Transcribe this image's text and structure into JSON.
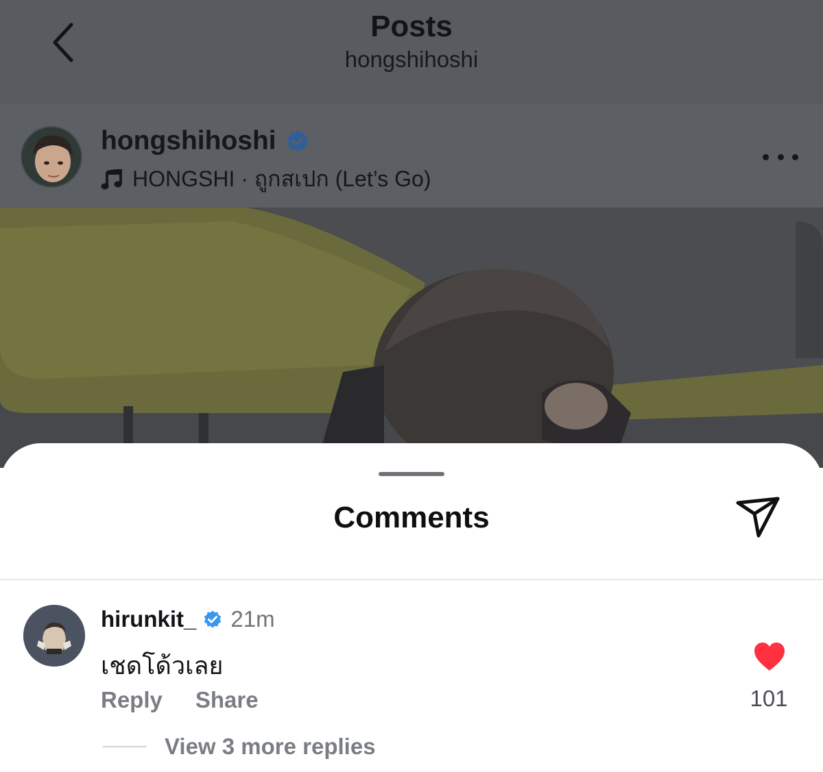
{
  "header": {
    "title": "Posts",
    "subtitle": "hongshihoshi"
  },
  "post": {
    "username": "hongshihoshi",
    "verified": true,
    "music": "HONGSHI · ถูกสเปก (Let’s Go)",
    "icons": {
      "back": "chevron-left-icon",
      "more": "more-horizontal-icon",
      "music": "music-note-icon"
    }
  },
  "sheet": {
    "title": "Comments",
    "send_icon": "send-icon"
  },
  "comment": {
    "username": "hirunkit_",
    "verified": true,
    "time": "21m",
    "text": "เชดโด้วเลย",
    "reply_label": "Reply",
    "share_label": "Share",
    "likes": "101",
    "liked": true,
    "view_replies": "View 3 more replies"
  },
  "colors": {
    "dim_overlay": "#585b60",
    "verified_blue": "#3897f0",
    "like_red": "#ff3040"
  }
}
